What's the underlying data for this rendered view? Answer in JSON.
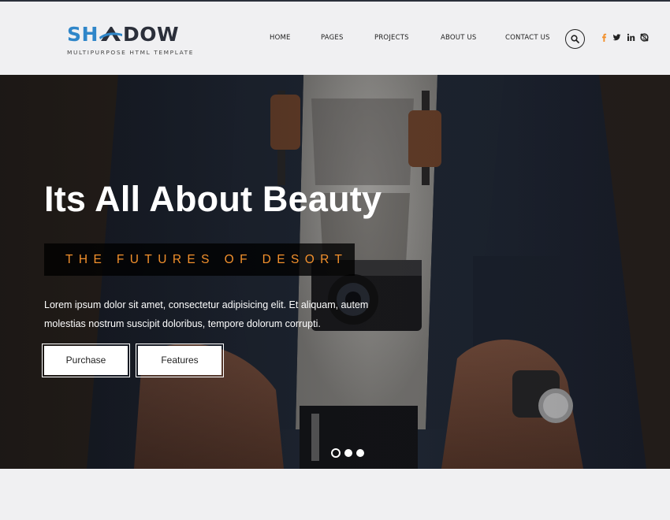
{
  "brand": {
    "name_left": "SH",
    "name_right": "DOW",
    "tagline": "MULTIPURPOSE HTML TEMPLATE",
    "colors": {
      "blue": "#2f86c9",
      "dark": "#2b2f3a"
    }
  },
  "nav": {
    "items": [
      {
        "label": "HOME"
      },
      {
        "label": "PAGES"
      },
      {
        "label": "PROJECTS"
      },
      {
        "label": "ABOUT US"
      },
      {
        "label": "CONTACT US"
      }
    ],
    "search_icon": "search-icon"
  },
  "social": {
    "icons": [
      "facebook-icon",
      "twitter-icon",
      "linkedin-icon",
      "skype-icon"
    ],
    "facebook_color": "#f2902c",
    "icon_color": "#222222"
  },
  "hero": {
    "title": "Its All About Beauty",
    "subtitle": "THE FUTURES OF DESORT",
    "subtitle_color": "#f2902c",
    "description": "Lorem ipsum dolor sit amet, consectetur adipisicing elit. Et aliquam, autem molestias nostrum suscipit doloribus, tempore dolorum corrupti.",
    "buttons": [
      {
        "label": "Purchase"
      },
      {
        "label": "Features"
      }
    ],
    "slides": {
      "count": 3,
      "active": 1
    }
  }
}
